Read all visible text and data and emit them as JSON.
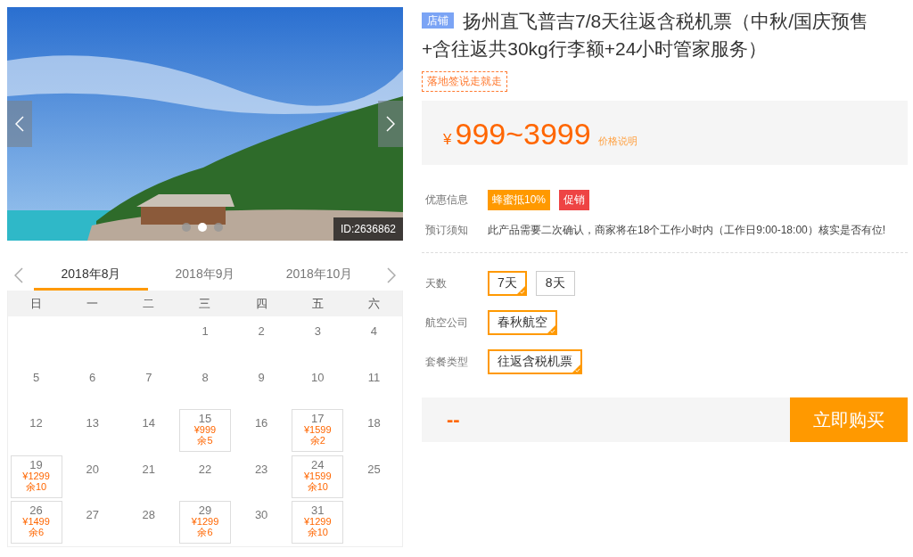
{
  "gallery": {
    "image_id": "ID:2636862",
    "dots": [
      {
        "selected": false
      },
      {
        "selected": true
      },
      {
        "selected": false
      }
    ]
  },
  "calendar": {
    "months": [
      {
        "label": "2018年8月",
        "selected": true
      },
      {
        "label": "2018年9月",
        "selected": false
      },
      {
        "label": "2018年10月",
        "selected": false
      }
    ],
    "weekdays": [
      "日",
      "一",
      "二",
      "三",
      "四",
      "五",
      "六"
    ],
    "weeks": [
      [
        {
          "kind": "blank"
        },
        {
          "kind": "blank"
        },
        {
          "kind": "blank"
        },
        {
          "kind": "plain",
          "day": "1"
        },
        {
          "kind": "plain",
          "day": "2"
        },
        {
          "kind": "plain",
          "day": "3"
        },
        {
          "kind": "plain",
          "day": "4"
        }
      ],
      [
        {
          "kind": "plain",
          "day": "5"
        },
        {
          "kind": "plain",
          "day": "6"
        },
        {
          "kind": "plain",
          "day": "7"
        },
        {
          "kind": "plain",
          "day": "8"
        },
        {
          "kind": "plain",
          "day": "9"
        },
        {
          "kind": "plain",
          "day": "10"
        },
        {
          "kind": "plain",
          "day": "11"
        }
      ],
      [
        {
          "kind": "plain",
          "day": "12"
        },
        {
          "kind": "plain",
          "day": "13"
        },
        {
          "kind": "plain",
          "day": "14"
        },
        {
          "kind": "priced",
          "day": "15",
          "price": "¥999",
          "remaining": "余5"
        },
        {
          "kind": "plain",
          "day": "16"
        },
        {
          "kind": "priced",
          "day": "17",
          "price": "¥1599",
          "remaining": "余2"
        },
        {
          "kind": "plain",
          "day": "18"
        }
      ],
      [
        {
          "kind": "priced",
          "day": "19",
          "price": "¥1299",
          "remaining": "余10"
        },
        {
          "kind": "plain",
          "day": "20"
        },
        {
          "kind": "plain",
          "day": "21"
        },
        {
          "kind": "plain",
          "day": "22"
        },
        {
          "kind": "plain",
          "day": "23"
        },
        {
          "kind": "priced",
          "day": "24",
          "price": "¥1599",
          "remaining": "余10"
        },
        {
          "kind": "plain",
          "day": "25"
        }
      ],
      [
        {
          "kind": "priced",
          "day": "26",
          "price": "¥1499",
          "remaining": "余6"
        },
        {
          "kind": "plain",
          "day": "27"
        },
        {
          "kind": "plain",
          "day": "28"
        },
        {
          "kind": "priced",
          "day": "29",
          "price": "¥1299",
          "remaining": "余6"
        },
        {
          "kind": "plain",
          "day": "30"
        },
        {
          "kind": "priced",
          "day": "31",
          "price": "¥1299",
          "remaining": "余10"
        },
        {
          "kind": "blank"
        }
      ]
    ]
  },
  "product": {
    "shop_badge": "店铺",
    "title": "扬州直飞普吉7/8天往返含税机票（中秋/国庆预售+含往返共30kg行李额+24小时管家服务）",
    "tag": "落地签说走就走",
    "price": {
      "currency": "¥",
      "range": "999~3999",
      "note": "价格说明"
    },
    "offers": {
      "label": "优惠信息",
      "badges": [
        {
          "text": "蜂蜜抵10%",
          "color": "#ff9900"
        },
        {
          "text": "促销",
          "color": "#ee4444"
        }
      ]
    },
    "notice": {
      "label": "预订须知",
      "text": "此产品需要二次确认，商家将在18个工作小时内（工作日9:00-18:00）核实是否有位!"
    },
    "options": [
      {
        "label": "天数",
        "choices": [
          {
            "text": "7天",
            "selected": true
          },
          {
            "text": "8天",
            "selected": false
          }
        ]
      },
      {
        "label": "航空公司",
        "choices": [
          {
            "text": "春秋航空",
            "selected": true
          }
        ]
      },
      {
        "label": "套餐类型",
        "choices": [
          {
            "text": "往返含税机票",
            "selected": true
          }
        ]
      }
    ],
    "total": "--",
    "buy_button": "立即购买"
  }
}
